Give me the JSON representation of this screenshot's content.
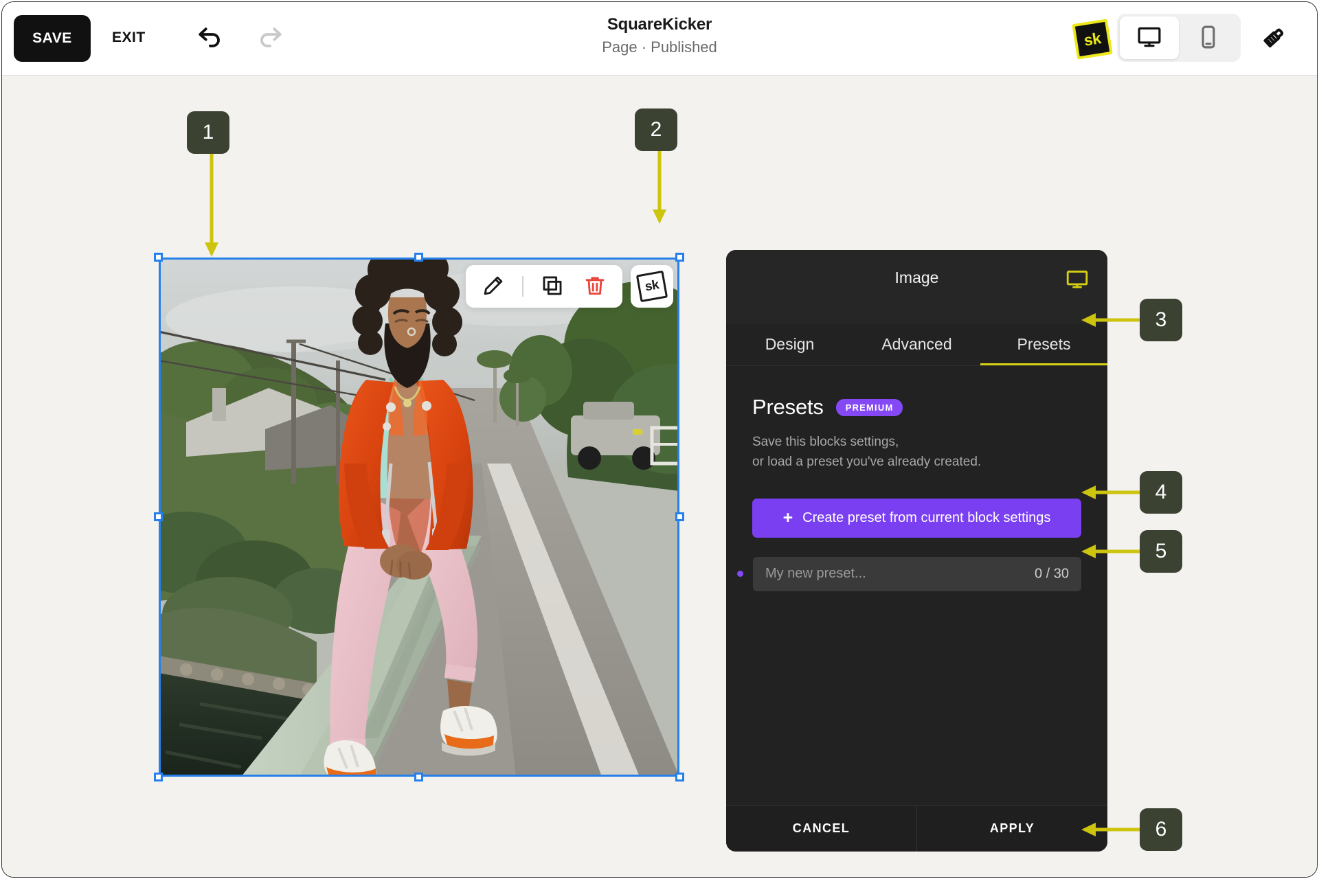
{
  "window": {
    "title": "SquareKicker",
    "subtitle": "Page · Published"
  },
  "topbar": {
    "save_label": "SAVE",
    "exit_label": "EXIT",
    "undo_icon": "undo-arrow-icon",
    "redo_icon": "redo-arrow-icon",
    "sk_badge_label": "sk",
    "device_desktop_icon": "monitor-icon",
    "device_mobile_icon": "phone-icon",
    "brush_icon": "paintbrush-icon",
    "active_device": "desktop"
  },
  "canvas": {
    "background_color": "#f4f2ef",
    "selection_color": "#2680eb",
    "selected_block": "image-block",
    "block_toolbar": {
      "edit_icon": "pencil-icon",
      "duplicate_icon": "duplicate-icon",
      "delete_icon": "trash-icon",
      "delete_color": "#e8443a",
      "sk_label": "sk"
    }
  },
  "panel": {
    "title": "Image",
    "monitor_icon": "monitor-icon",
    "accent_color": "#d6cf13",
    "tabs": [
      {
        "label": "Design",
        "active": false
      },
      {
        "label": "Advanced",
        "active": false
      },
      {
        "label": "Presets",
        "active": true
      }
    ],
    "presets": {
      "heading": "Presets",
      "badge": "PREMIUM",
      "badge_color": "#8448f5",
      "description_line1": "Save this blocks settings,",
      "description_line2": "or load a preset you've already created.",
      "create_button": "Create preset from current block settings",
      "create_button_color": "#7b3ff2",
      "create_button_icon": "plus-icon",
      "input_placeholder": "My new preset...",
      "input_value": "",
      "char_counter": "0 / 30",
      "dot_color": "#8448f5"
    },
    "footer": {
      "cancel_label": "CANCEL",
      "apply_label": "APPLY"
    }
  },
  "callouts": {
    "accent_color": "#cdc40f",
    "badge_color": "#3b4232",
    "items": [
      {
        "number": "1",
        "direction": "down"
      },
      {
        "number": "2",
        "direction": "down"
      },
      {
        "number": "3",
        "direction": "left"
      },
      {
        "number": "4",
        "direction": "left"
      },
      {
        "number": "5",
        "direction": "left"
      },
      {
        "number": "6",
        "direction": "left"
      }
    ]
  }
}
